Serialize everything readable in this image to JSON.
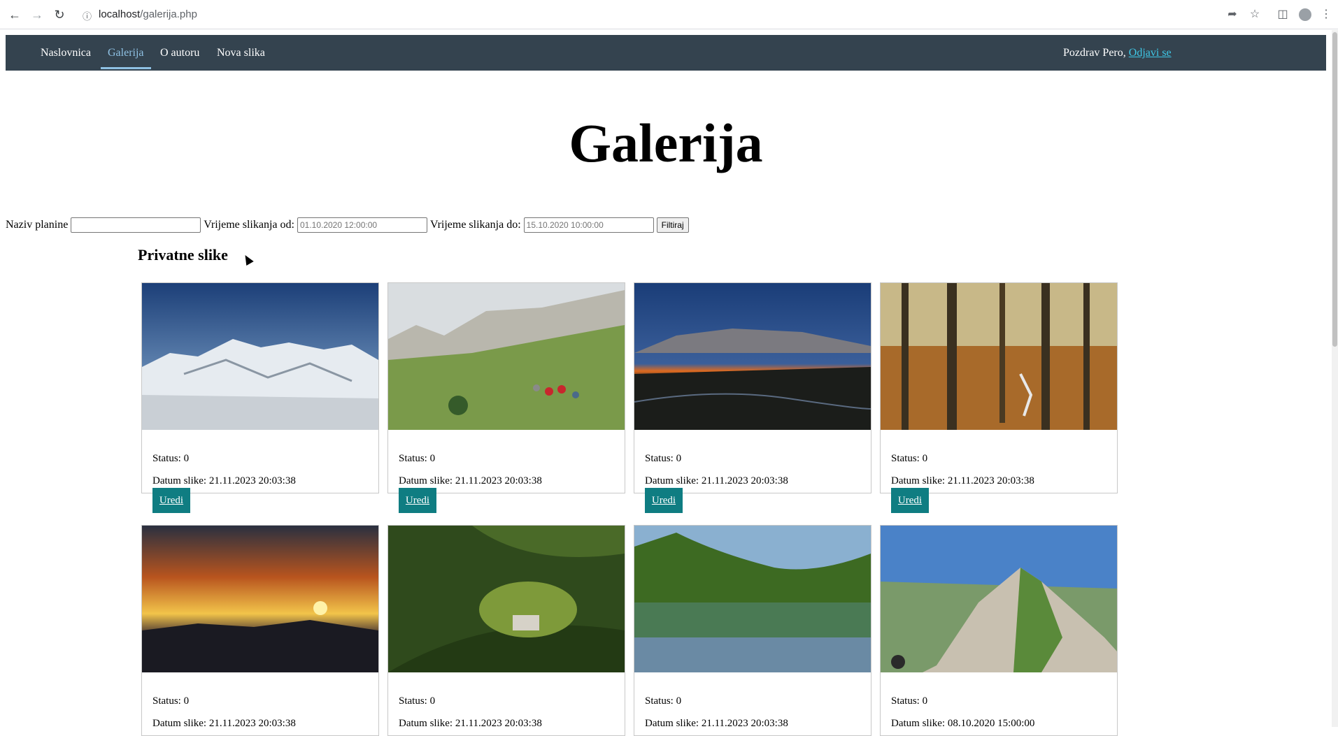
{
  "browser": {
    "url_host": "localhost",
    "url_path": "/galerija.php"
  },
  "nav": {
    "items": [
      {
        "label": "Naslovnica",
        "active": false
      },
      {
        "label": "Galerija",
        "active": true
      },
      {
        "label": "O autoru",
        "active": false
      },
      {
        "label": "Nova slika",
        "active": false
      }
    ],
    "greeting": "Pozdrav Pero,",
    "logout_label": "Odjavi se"
  },
  "page": {
    "title": "Galerija",
    "section_title": "Privatne slike"
  },
  "filter": {
    "mountain_label": "Naziv planine",
    "mountain_value": "",
    "from_label": "Vrijeme slikanja od:",
    "from_placeholder": "01.10.2020 12:00:00",
    "to_label": "Vrijeme slikanja do:",
    "to_placeholder": "15.10.2020 10:00:00",
    "submit_label": "Filtiraj"
  },
  "cards": [
    {
      "status": "Status: 0",
      "date": "Datum slike: 21.11.2023 20:03:38",
      "edit": "Uredi",
      "scene": "snowy-mountain"
    },
    {
      "status": "Status: 0",
      "date": "Datum slike: 21.11.2023 20:03:38",
      "edit": "Uredi",
      "scene": "hikers"
    },
    {
      "status": "Status: 0",
      "date": "Datum slike: 21.11.2023 20:03:38",
      "edit": "Uredi",
      "scene": "dusk-ridge"
    },
    {
      "status": "Status: 0",
      "date": "Datum slike: 21.11.2023 20:03:38",
      "edit": "Uredi",
      "scene": "autumn-forest"
    },
    {
      "status": "Status: 0",
      "date": "Datum slike: 21.11.2023 20:03:38",
      "edit": "",
      "scene": "sunset"
    },
    {
      "status": "Status: 0",
      "date": "Datum slike: 21.11.2023 20:03:38",
      "edit": "",
      "scene": "castle-valley"
    },
    {
      "status": "Status: 0",
      "date": "Datum slike: 21.11.2023 20:03:38",
      "edit": "",
      "scene": "lake"
    },
    {
      "status": "Status: 0",
      "date": "Datum slike: 08.10.2020 15:00:00",
      "edit": "",
      "scene": "rocky-peak"
    }
  ]
}
